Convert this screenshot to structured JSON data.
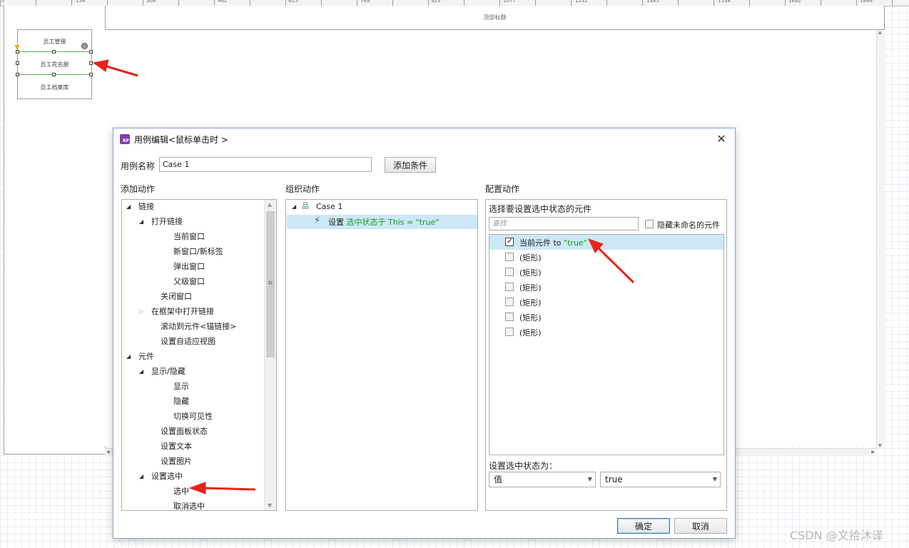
{
  "ruler": {
    "labels": [
      "0",
      "154",
      "308",
      "462",
      "615",
      "769",
      "923",
      "1077",
      "1231",
      "1385",
      "1538",
      "1692",
      "1846"
    ]
  },
  "canvas": {
    "header_text": "顶部标题",
    "nav_items": [
      "员工管理",
      "员工花名册",
      "员工档案库"
    ]
  },
  "dialog": {
    "title": "用例编辑<鼠标单击时 >",
    "close": "✕",
    "case_name_label": "用例名称",
    "case_name_value": "Case 1",
    "add_condition": "添加条件",
    "add_action_label": "添加动作",
    "organize_label": "组织动作",
    "configure_label": "配置动作",
    "action_tree": [
      {
        "label": "链接",
        "toggle": "◢"
      },
      {
        "label": "打开链接",
        "toggle": "◢"
      },
      {
        "label": "当前窗口"
      },
      {
        "label": "新窗口/新标签"
      },
      {
        "label": "弹出窗口"
      },
      {
        "label": "父级窗口"
      },
      {
        "label": "关闭窗口"
      },
      {
        "label": "在框架中打开链接",
        "toggle": "▷"
      },
      {
        "label": "滚动到元件<锚链接>"
      },
      {
        "label": "设置自适应视图"
      },
      {
        "label": "元件",
        "toggle": "◢"
      },
      {
        "label": "显示/隐藏",
        "toggle": "◢"
      },
      {
        "label": "显示"
      },
      {
        "label": "隐藏"
      },
      {
        "label": "切换可见性"
      },
      {
        "label": "设置面板状态"
      },
      {
        "label": "设置文本"
      },
      {
        "label": "设置图片"
      },
      {
        "label": "设置选中",
        "toggle": "◢"
      },
      {
        "label": "选中"
      },
      {
        "label": "取消选中"
      }
    ],
    "organize": {
      "case_label": "Case 1",
      "action_prefix": "设置 ",
      "action_detail": "选中状态于 This = \"true\""
    },
    "configure": {
      "select_label": "选择要设置选中状态的元件",
      "search_placeholder": "查找",
      "hide_unnamed": "隐藏未命名的元件",
      "elements": [
        {
          "label": "当前元件 to ",
          "value": "\"true\"",
          "checked": true
        },
        {
          "label": "(矩形)"
        },
        {
          "label": "(矩形)"
        },
        {
          "label": "(矩形)"
        },
        {
          "label": "(矩形)"
        },
        {
          "label": "(矩形)"
        },
        {
          "label": "(矩形)"
        }
      ],
      "set_state_label": "设置选中状态为：",
      "mode_value": "值",
      "state_value": "true"
    },
    "ok": "确定",
    "cancel": "取消"
  },
  "watermark": "CSDN @文拾沐译",
  "colors": {
    "selection": "#cce8f6",
    "accent_green": "#1d9a1d",
    "arrow_red": "#e8231b",
    "logo_purple": "#7d3fb5"
  }
}
